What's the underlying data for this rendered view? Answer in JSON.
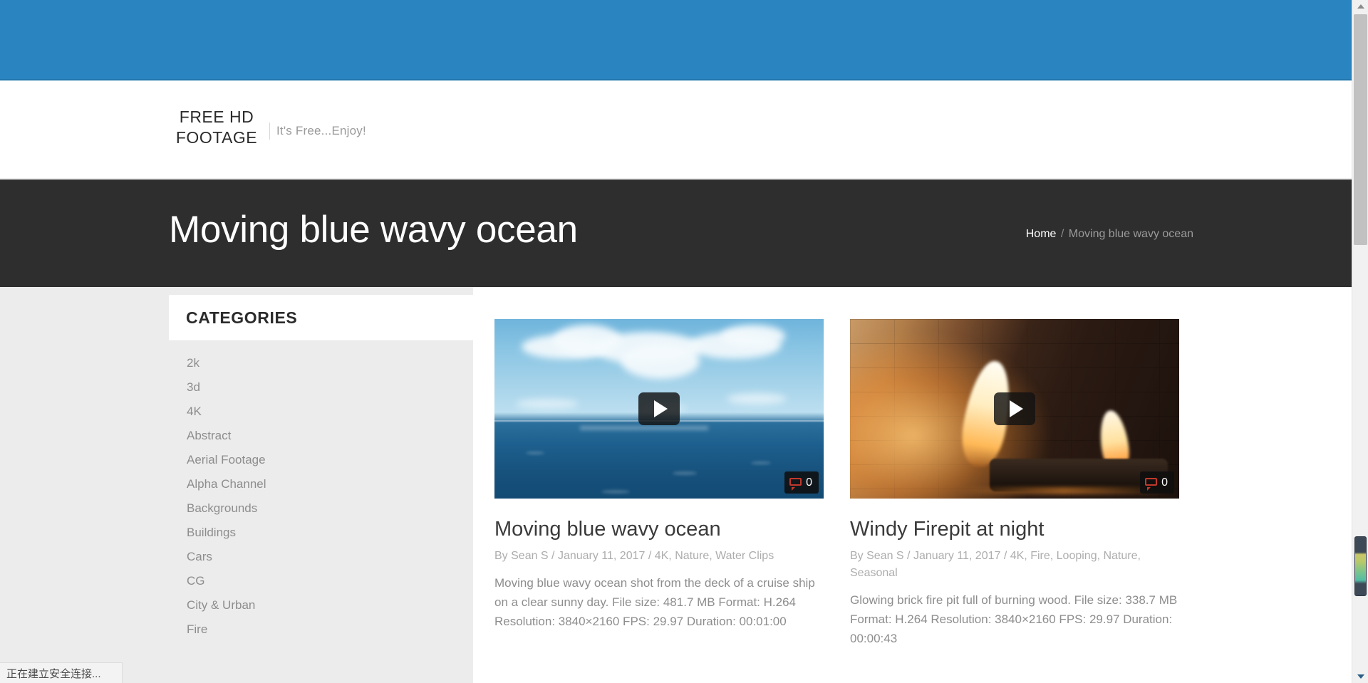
{
  "site": {
    "logo_line1": "FREE HD",
    "logo_line2": "FOOTAGE",
    "tagline": "It's Free...Enjoy!"
  },
  "page": {
    "title": "Moving blue wavy ocean",
    "breadcrumb_home": "Home",
    "breadcrumb_sep": "/",
    "breadcrumb_current": "Moving blue wavy ocean"
  },
  "sidebar": {
    "widget_title": "CATEGORIES",
    "categories": [
      {
        "label": "2k"
      },
      {
        "label": "3d"
      },
      {
        "label": "4K"
      },
      {
        "label": "Abstract"
      },
      {
        "label": "Aerial Footage"
      },
      {
        "label": "Alpha Channel"
      },
      {
        "label": "Backgrounds"
      },
      {
        "label": "Buildings"
      },
      {
        "label": "Cars"
      },
      {
        "label": "CG"
      },
      {
        "label": "City & Urban"
      },
      {
        "label": "Fire"
      }
    ]
  },
  "cards": [
    {
      "title": "Moving blue wavy ocean",
      "meta": "By Sean S / January 11, 2017 / 4K, Nature, Water Clips",
      "description": "Moving blue wavy ocean shot from the deck of a cruise ship on a clear sunny day. File size: 481.7 MB Format: H.264 Resolution: 3840×2160 FPS: 29.97 Duration: 00:01:00",
      "comment_count": "0",
      "play_icon": "play-icon",
      "comment_icon": "comment-bubble-icon"
    },
    {
      "title": "Windy Firepit at night",
      "meta": "By Sean S / January 11, 2017 / 4K, Fire, Looping, Nature, Seasonal",
      "description": "Glowing brick fire pit full of burning wood. File size: 338.7 MB Format: H.264 Resolution: 3840×2160 FPS: 29.97 Duration: 00:00:43",
      "comment_count": "0",
      "play_icon": "play-icon",
      "comment_icon": "comment-bubble-icon"
    }
  ],
  "browser": {
    "status_text": "正在建立安全连接...",
    "scroll_up_icon": "triangle-up-icon",
    "scroll_down_icon": "triangle-down-icon"
  },
  "colors": {
    "banner_blue": "#2a84bf",
    "title_bar_dark": "#2e2e2e",
    "page_bg": "#ececec",
    "badge_red": "#c0392b"
  }
}
